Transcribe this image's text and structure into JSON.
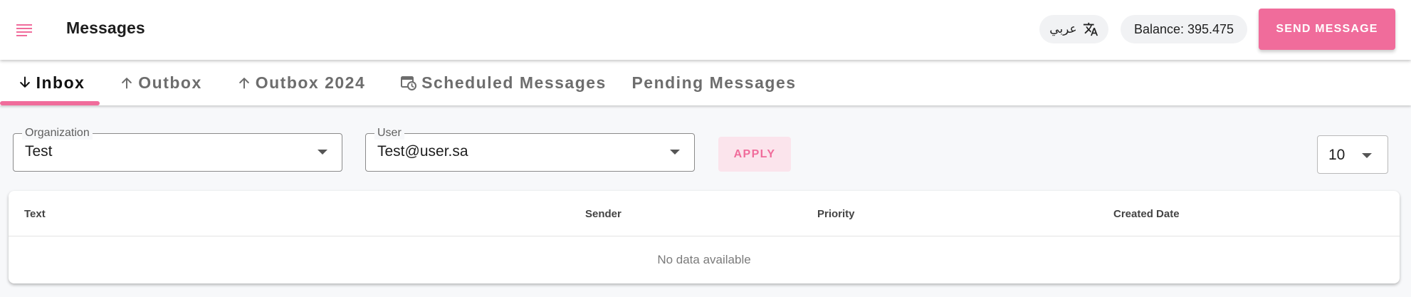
{
  "header": {
    "title": "Messages",
    "language_label": "عربي",
    "balance": "Balance: 395.475",
    "send_button": "SEND MESSAGE",
    "accent_color": "#f06c9b"
  },
  "tabs": [
    {
      "label": "Inbox",
      "icon": "arrow-down-icon",
      "active": true
    },
    {
      "label": "Outbox",
      "icon": "arrow-up-icon",
      "active": false
    },
    {
      "label": "Outbox 2024",
      "icon": "arrow-up-icon",
      "active": false
    },
    {
      "label": "Scheduled Messages",
      "icon": "scheduled-calendar-icon",
      "active": false
    },
    {
      "label": "Pending Messages",
      "icon": null,
      "active": false
    }
  ],
  "filters": {
    "organization": {
      "label": "Organization",
      "value": "Test"
    },
    "user": {
      "label": "User",
      "value": "Test@user.sa"
    },
    "apply_button": "APPLY",
    "per_page": "10"
  },
  "table": {
    "columns": [
      "Text",
      "Sender",
      "Priority",
      "Created Date"
    ],
    "rows": [],
    "empty_text": "No data available"
  }
}
